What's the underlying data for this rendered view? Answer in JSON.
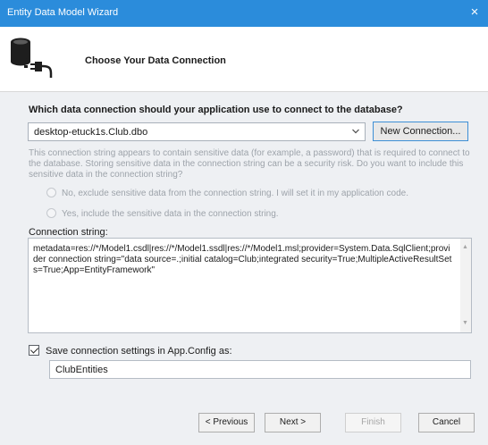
{
  "window": {
    "title": "Entity Data Model Wizard",
    "close_glyph": "×"
  },
  "header": {
    "title": "Choose Your Data Connection",
    "icon": "database-connection-icon"
  },
  "connection": {
    "question": "Which data connection should your application use to connect to the database?",
    "selected": "desktop-etuck1s.Club.dbo",
    "new_connection_label": "New Connection...",
    "warning": "This connection string appears to contain sensitive data (for example, a password) that is required to connect to the database. Storing sensitive data in the connection string can be a security risk. Do you want to include this sensitive data in the connection string?",
    "option_exclude": "No, exclude sensitive data from the connection string. I will set it in my application code.",
    "option_include": "Yes, include the sensitive data in the connection string.",
    "string_label": "Connection string:",
    "string_value": "metadata=res://*/Model1.csdl|res://*/Model1.ssdl|res://*/Model1.msl;provider=System.Data.SqlClient;provider connection string=\"data source=.;initial catalog=Club;integrated security=True;MultipleActiveResultSets=True;App=EntityFramework\""
  },
  "save": {
    "label": "Save connection settings in App.Config as:",
    "checked": true,
    "value": "ClubEntities"
  },
  "buttons": {
    "previous": "< Previous",
    "next": "Next >",
    "finish": "Finish",
    "cancel": "Cancel"
  },
  "colors": {
    "titlebar": "#2b8cdb",
    "content_bg": "#eef0f3",
    "accent_border": "#3d8fd6"
  }
}
